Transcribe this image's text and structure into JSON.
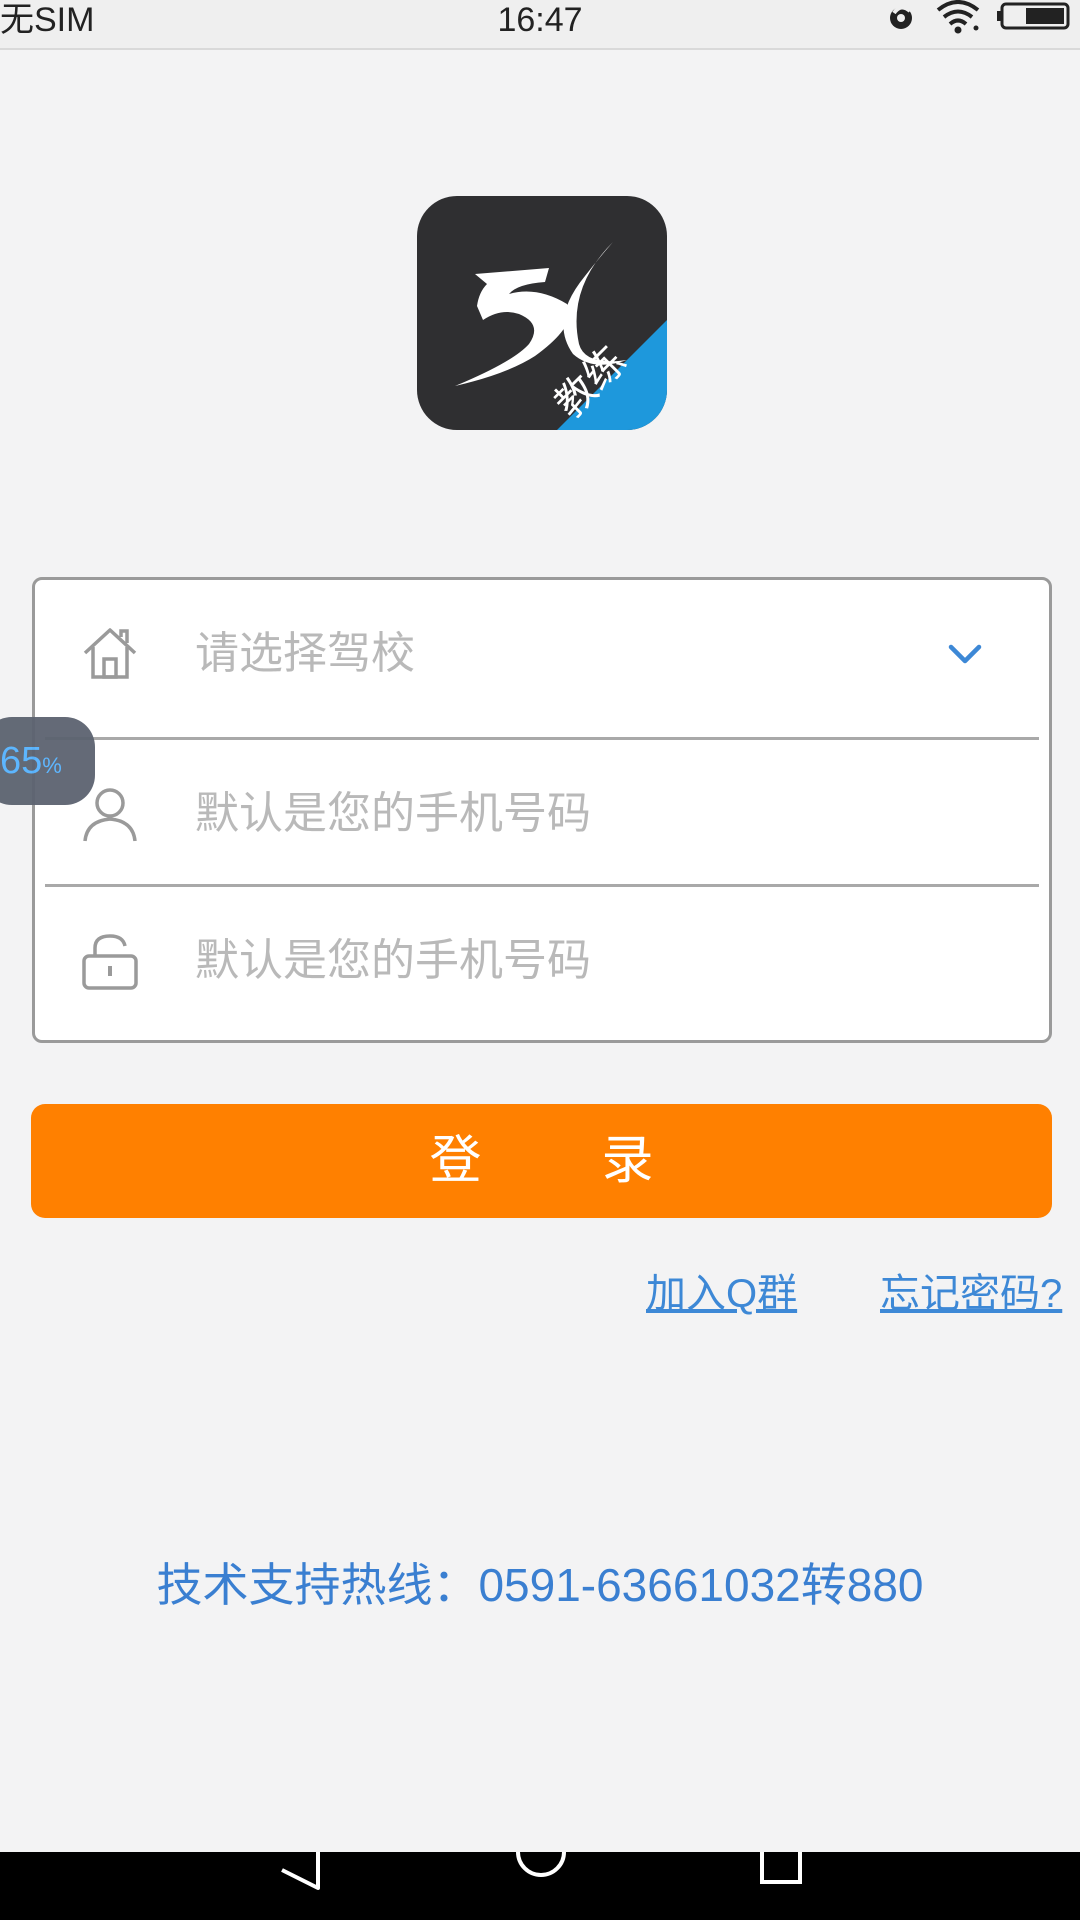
{
  "status_bar": {
    "carrier": "无SIM",
    "time": "16:47",
    "icons": [
      "alarm-icon",
      "wifi-icon",
      "battery-icon"
    ]
  },
  "logo": {
    "ribbon_text": "教练",
    "background": "#2f2f31",
    "ribbon_color": "#1e98dc"
  },
  "form": {
    "school_select": {
      "placeholder": "请选择驾校",
      "icon": "house-icon"
    },
    "phone_field": {
      "placeholder": "默认是您的手机号码",
      "icon": "user-icon"
    },
    "password_field": {
      "placeholder": "默认是您的手机号码",
      "icon": "lock-icon"
    }
  },
  "login_button": {
    "label": "登录",
    "color": "#ff8000"
  },
  "links": {
    "join_qq": "加入Q群",
    "forgot_password": "忘记密码?"
  },
  "hotline": "技术支持热线：0591-63661032转880",
  "float_badge": {
    "value": "65",
    "unit": "%"
  },
  "nav_bar": {
    "buttons": [
      "back-icon",
      "home-icon",
      "recents-icon"
    ]
  },
  "colors": {
    "accent_link": "#3d88d6",
    "placeholder": "#b9b9b9",
    "background": "#f3f3f4"
  }
}
